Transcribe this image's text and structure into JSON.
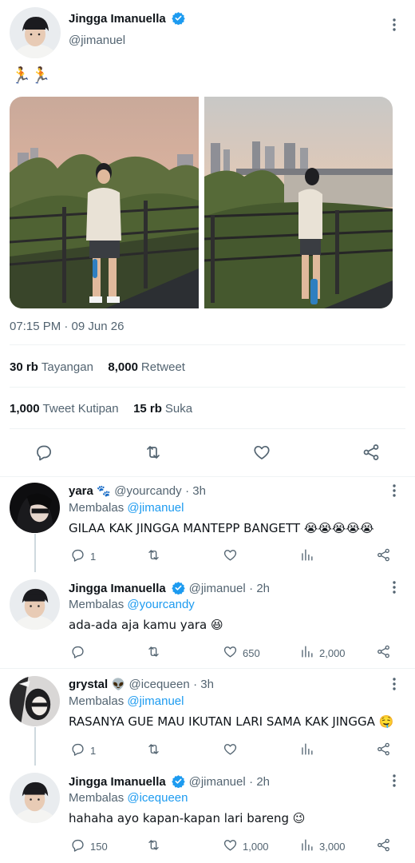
{
  "main_tweet": {
    "author_name": "Jingga Imanuella",
    "author_handle": "@jimanuel",
    "text": "🏃🏃",
    "timestamp": "07:15 PM · 09 Jun 26",
    "stats": [
      {
        "num": "30 rb",
        "label": "Tayangan"
      },
      {
        "num": "8,000",
        "label": "Retweet"
      },
      {
        "num": "1,000",
        "label": "Tweet Kutipan"
      },
      {
        "num": "15 rb",
        "label": "Suka"
      }
    ],
    "actions": [
      "reply-icon",
      "retweet-icon",
      "like-icon",
      "share-icon"
    ]
  },
  "replies": [
    {
      "name": "yara",
      "name_emoji": "🐾",
      "handle": "@yourcandy",
      "time": "· 3h",
      "replying_prefix": "Membalas",
      "replying_to": "@jimanuel",
      "text": "GILAA KAK JINGGA MANTEPP BANGETT 😭😭😭😭😭",
      "reply_count": "1",
      "retweet_count": "",
      "like_count": "",
      "views_count": ""
    },
    {
      "name": "Jingga Imanuella",
      "handle": "@jimanuel",
      "time": "· 2h",
      "replying_prefix": "Membalas",
      "replying_to": "@yourcandy",
      "text": "ada-ada aja kamu yara 😆",
      "reply_count": "",
      "retweet_count": "",
      "like_count": "650",
      "views_count": "2,000"
    },
    {
      "name": "grystal",
      "name_emoji": "👽",
      "handle": "@icequeen",
      "time": "· 3h",
      "replying_prefix": "Membalas",
      "replying_to": "@jimanuel",
      "text": "RASANYA GUE MAU IKUTAN LARI SAMA KAK JINGGA 🤤",
      "reply_count": "1",
      "retweet_count": "",
      "like_count": "",
      "views_count": ""
    },
    {
      "name": "Jingga Imanuella",
      "handle": "@jimanuel",
      "time": "· 2h",
      "replying_prefix": "Membalas",
      "replying_to": "@icequeen",
      "text": "hahaha ayo kapan-kapan lari bareng 😉",
      "reply_count": "150",
      "retweet_count": "",
      "like_count": "1,000",
      "views_count": "3,000"
    }
  ],
  "colors": {
    "accent": "#1d9bf0",
    "text": "#0f1419",
    "secondary": "#536471",
    "divider": "#eff3f4"
  }
}
